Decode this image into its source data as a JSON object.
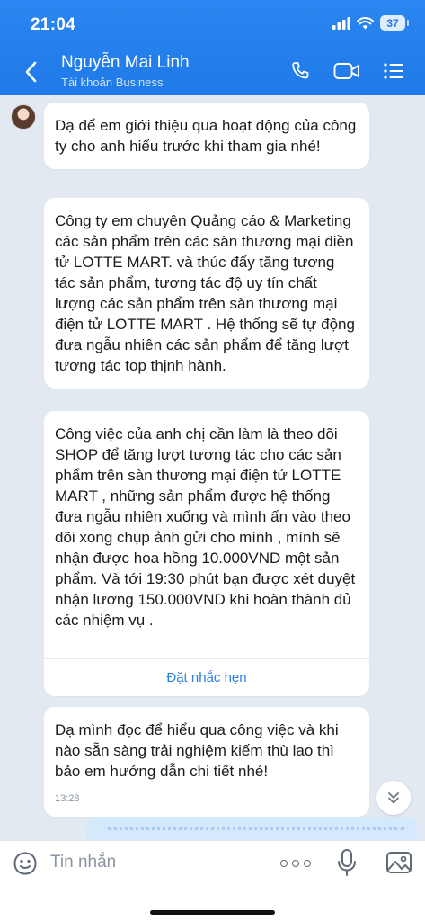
{
  "status_bar": {
    "time": "21:04",
    "battery": "37"
  },
  "header": {
    "contact_name": "Nguyễn Mai Linh",
    "contact_subtitle": "Tài khoản Business"
  },
  "messages": [
    {
      "text": "Dạ để em giới thiệu qua hoạt động của công ty cho anh hiểu trước khi tham gia nhé!"
    },
    {
      "text": "Công ty em chuyên Quảng cáo & Marketing các sản phẩm trên các sàn thương mại điền tử LOTTE MART.  và thúc đẩy tăng tương tác sản phẩm, tương tác độ uy tín chất lượng các sản phẩm trên sàn thương mại điện tử LOTTE MART   . Hệ thống sẽ tự động đưa ngẫu nhiên các sản phẩm để tăng lượt tương tác top thịnh hành."
    },
    {
      "text": "Công việc của anh chị cần làm là theo dõi SHOP để tăng lượt tương tác cho các sản phẩm trên sàn thương mại điện tử LOTTE MART  , những sản phẩm được hệ thống đưa ngẫu nhiên xuống và mình ấn vào theo dõi xong chụp ảnh gửi cho mình , mình sẽ nhận được hoa hồng 10.000VND một sản phẩm. Và tới 19:30 phút  bạn được xét duyệt nhận lương 150.000VND khi hoàn thành đủ các nhiệm vụ .",
      "action": "Đặt nhắc hẹn"
    },
    {
      "text": "Dạ mình đọc để hiểu qua công việc và khi nào sẵn sàng trải nghiệm kiếm thù lao thì bảo em hướng dẫn chi tiết nhé!",
      "time": "13:28"
    }
  ],
  "input": {
    "placeholder": "Tin nhắn"
  },
  "colors": {
    "header": "#1f7ae8",
    "chat_bg": "#e3e9f1",
    "link": "#2d7fe4",
    "outgoing_bubble": "#d5e9fd"
  },
  "icons": [
    "back-arrow",
    "phone",
    "video-camera",
    "menu-list",
    "chevron-double-down",
    "emoji",
    "more-dots",
    "microphone",
    "image"
  ]
}
